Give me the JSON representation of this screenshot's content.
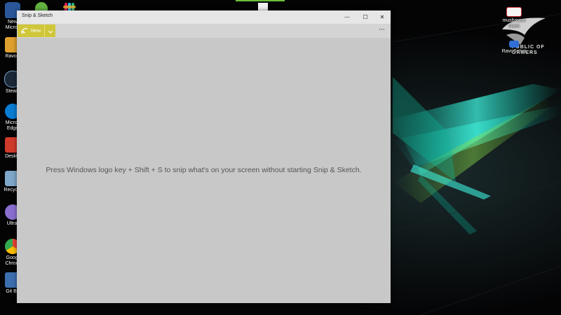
{
  "window": {
    "title": "Snip & Sketch",
    "minimize_glyph": "—",
    "maximize_glyph": "☐",
    "close_glyph": "✕",
    "new_label": "New",
    "more_glyph": "···",
    "hint": "Press Windows logo key + Shift + S to snip what's on your screen without starting Snip & Sketch."
  },
  "desktop": {
    "left_icons": [
      {
        "label": "New\nMicros",
        "icon": "word-doc-icon",
        "color": "#2b579a"
      },
      {
        "label": "RavoP",
        "icon": "app-icon",
        "color": "#e0a030"
      },
      {
        "label": "Steam",
        "icon": "steam-icon",
        "color": "#1b2838"
      },
      {
        "label": "Micros\nEdge",
        "icon": "edge-icon",
        "color": "#0a7dd3"
      },
      {
        "label": "Deskto",
        "icon": "folder-pdf-icon",
        "color": "#d03a2a"
      },
      {
        "label": "Recycle",
        "icon": "recycle-bin-icon",
        "color": "#7fa7c9"
      },
      {
        "label": "UltraI",
        "icon": "disc-icon",
        "color": "#8a6fd1"
      },
      {
        "label": "Googl\nChrom",
        "icon": "chrome-icon",
        "color": "#34a853"
      },
      {
        "label": "Git Ba",
        "icon": "git-bash-icon",
        "color": "#3d6fb0"
      }
    ],
    "right_icons": [
      {
        "label": "mushroom\nclass",
        "icon": "document-icon"
      },
      {
        "label": "RavoSetup",
        "icon": "installer-icon"
      }
    ],
    "wallpaper_text": [
      "PUBLIC OF",
      "GAMERS"
    ]
  }
}
